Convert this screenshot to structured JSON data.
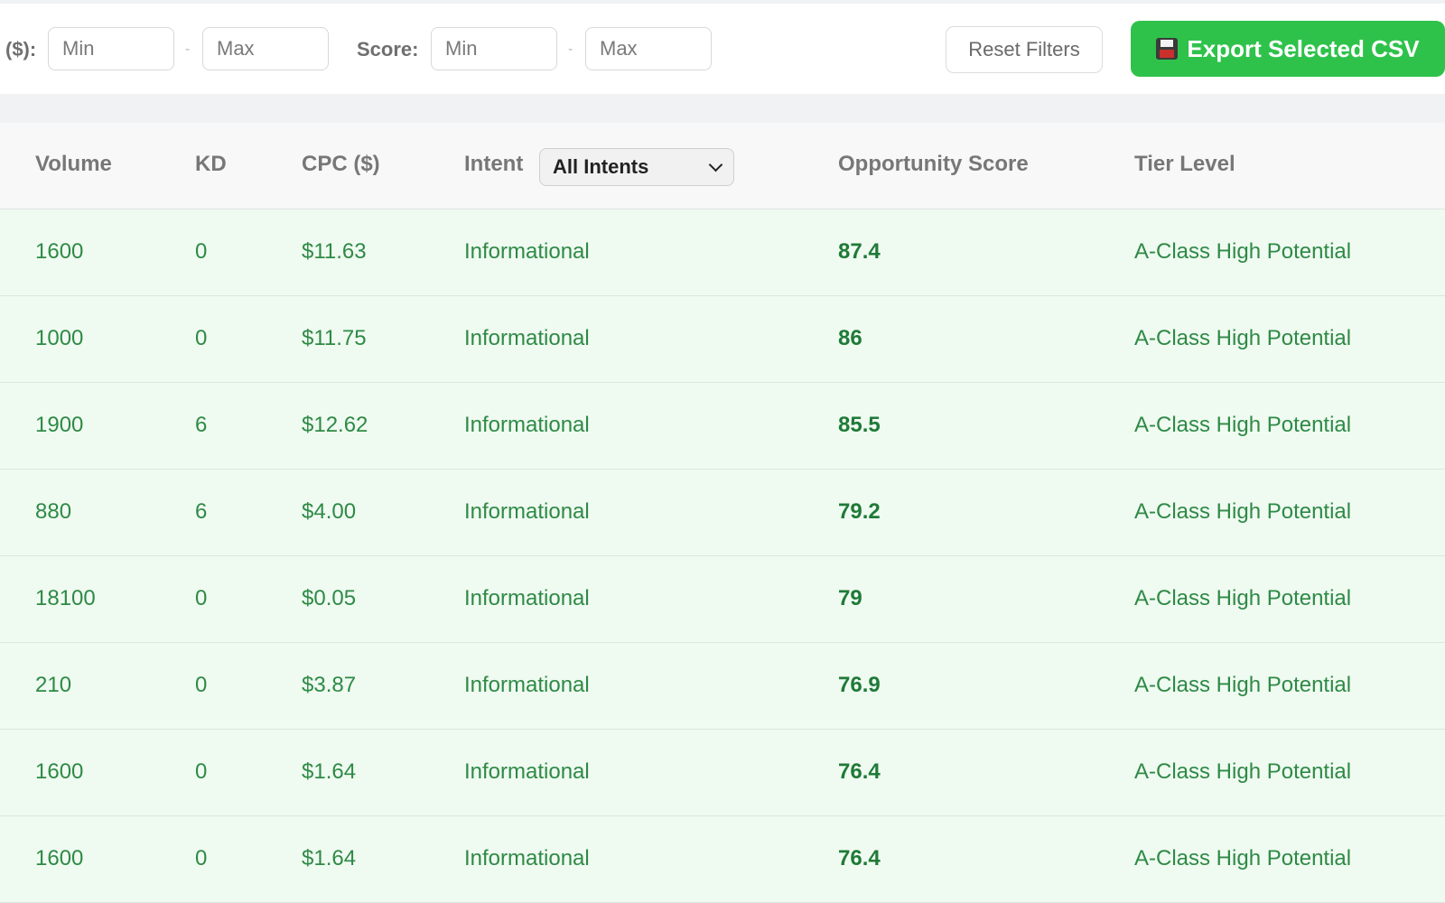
{
  "filters": {
    "cpc_label": "($):",
    "score_label": "Score:",
    "cpc_min_placeholder": "Min",
    "cpc_max_placeholder": "Max",
    "score_min_placeholder": "Min",
    "score_max_placeholder": "Max",
    "separator": "-",
    "reset_label": "Reset Filters",
    "export_label": "Export Selected CSV"
  },
  "table": {
    "headers": {
      "volume": "Volume",
      "kd": "KD",
      "cpc": "CPC ($)",
      "intent": "Intent",
      "score": "Opportunity Score",
      "tier": "Tier Level"
    },
    "intent_filter": {
      "selected": "All Intents"
    },
    "rows": [
      {
        "volume": "1600",
        "kd": "0",
        "cpc": "$11.63",
        "intent": "Informational",
        "score": "87.4",
        "tier": "A-Class High Potential"
      },
      {
        "volume": "1000",
        "kd": "0",
        "cpc": "$11.75",
        "intent": "Informational",
        "score": "86",
        "tier": "A-Class High Potential"
      },
      {
        "volume": "1900",
        "kd": "6",
        "cpc": "$12.62",
        "intent": "Informational",
        "score": "85.5",
        "tier": "A-Class High Potential"
      },
      {
        "volume": "880",
        "kd": "6",
        "cpc": "$4.00",
        "intent": "Informational",
        "score": "79.2",
        "tier": "A-Class High Potential"
      },
      {
        "volume": "18100",
        "kd": "0",
        "cpc": "$0.05",
        "intent": "Informational",
        "score": "79",
        "tier": "A-Class High Potential"
      },
      {
        "volume": "210",
        "kd": "0",
        "cpc": "$3.87",
        "intent": "Informational",
        "score": "76.9",
        "tier": "A-Class High Potential"
      },
      {
        "volume": "1600",
        "kd": "0",
        "cpc": "$1.64",
        "intent": "Informational",
        "score": "76.4",
        "tier": "A-Class High Potential"
      },
      {
        "volume": "1600",
        "kd": "0",
        "cpc": "$1.64",
        "intent": "Informational",
        "score": "76.4",
        "tier": "A-Class High Potential"
      }
    ]
  },
  "icons": {
    "export": "floppy-disk-icon",
    "select": "chevron-down-icon"
  },
  "colors": {
    "export_button": "#2fc24b",
    "row_background": "#effaf1",
    "row_text": "#2e8a45"
  }
}
